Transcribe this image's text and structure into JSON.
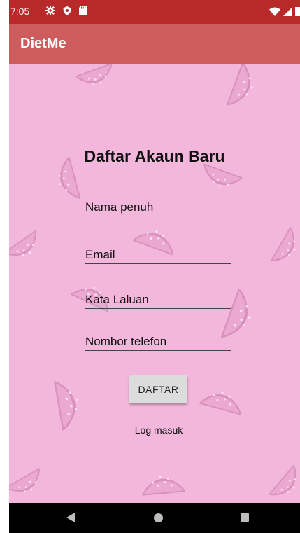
{
  "status_bar": {
    "time": "7:05"
  },
  "app_bar": {
    "title": "DietMe"
  },
  "form": {
    "title": "Daftar Akaun Baru",
    "fields": [
      {
        "placeholder": "Nama penuh",
        "value": ""
      },
      {
        "placeholder": "Email",
        "value": ""
      },
      {
        "placeholder": "Kata Laluan",
        "value": ""
      },
      {
        "placeholder": "Nombor telefon",
        "value": ""
      }
    ],
    "submit_label": "DAFTAR",
    "login_link": "Log masuk"
  },
  "colors": {
    "status_bar": "#b8292a",
    "app_bar": "#cf5c5d",
    "background": "#f3b7dc",
    "button": "#dcdcdc"
  },
  "icons": [
    "settings-icon",
    "shield-icon",
    "sd-card-icon",
    "wifi-icon",
    "signal-icon",
    "battery-icon",
    "back-icon",
    "home-icon",
    "recents-icon"
  ]
}
